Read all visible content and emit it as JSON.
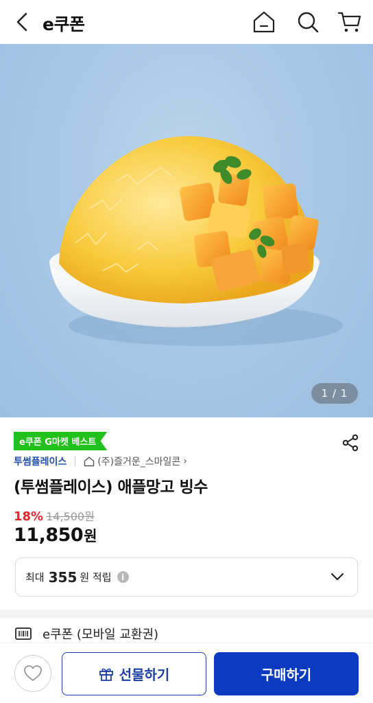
{
  "header": {
    "title": "e쿠폰",
    "back_icon": "chevron-left-icon",
    "home_icon": "home-icon",
    "search_icon": "search-icon",
    "cart_icon": "cart-icon"
  },
  "gallery": {
    "image_alt": "애플망고 빙수",
    "pager": "1 / 1"
  },
  "product": {
    "badge": "e쿠폰 G마켓 베스트",
    "brand": "투썸플레이스",
    "seller": "(주)즐거운_스마일콘",
    "seller_chevron": "›",
    "title": "(투썸플레이스) 애플망고 빙수",
    "discount": "18%",
    "original_price": "14,500원",
    "sale_price": "11,850",
    "sale_unit": "원"
  },
  "points": {
    "prefix": "최대",
    "amount": "355",
    "suffix": "원 적립",
    "info_glyph": "i"
  },
  "ticket": {
    "label": "e쿠폰 (모바일 교환권)"
  },
  "bottom": {
    "gift_label": "선물하기",
    "buy_label": "구매하기"
  },
  "colors": {
    "badge_green": "#22c01b",
    "discount_red": "#e0262e",
    "brand_blue": "#1f4fa8",
    "buy_blue": "#0b3ac1"
  }
}
